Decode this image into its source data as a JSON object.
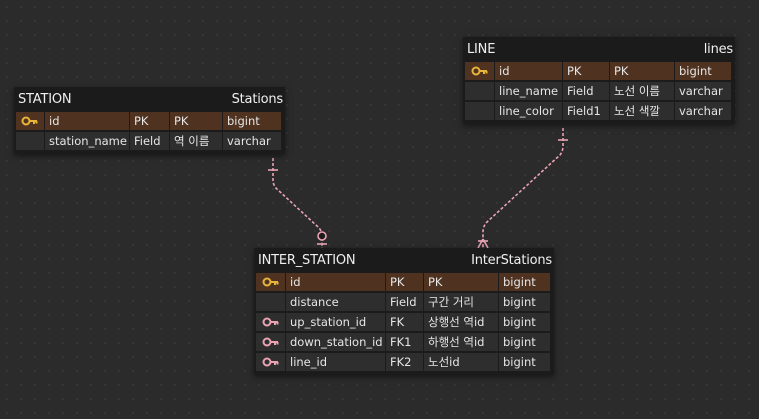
{
  "colors": {
    "background": "#2b2b2b",
    "table_bg": "#1b1b1b",
    "pk_row": "#4f3320",
    "cell": "#2e2e2e",
    "pk_key_icon": "#e8b53a",
    "fk_key_icon": "#e9a3b3",
    "connector": "#e9a3b3"
  },
  "entities": {
    "station": {
      "name": "STATION",
      "table": "Stations",
      "rows": [
        {
          "icon": "primary-key-icon",
          "name": "id",
          "key": "PK",
          "comment": "PK",
          "type": "bigint"
        },
        {
          "icon": "",
          "name": "station_name",
          "key": "Field",
          "comment": "역 이름",
          "type": "varchar"
        }
      ]
    },
    "line": {
      "name": "LINE",
      "table": "lines",
      "rows": [
        {
          "icon": "primary-key-icon",
          "name": "id",
          "key": "PK",
          "comment": "PK",
          "type": "bigint"
        },
        {
          "icon": "",
          "name": "line_name",
          "key": "Field",
          "comment": "노선 이름",
          "type": "varchar"
        },
        {
          "icon": "",
          "name": "line_color",
          "key": "Field1",
          "comment": "노선 색깔",
          "type": "varchar"
        }
      ]
    },
    "inter_station": {
      "name": "INTER_STATION",
      "table": "InterStations",
      "rows": [
        {
          "icon": "primary-key-icon",
          "name": "id",
          "key": "PK",
          "comment": "PK",
          "type": "bigint"
        },
        {
          "icon": "",
          "name": "distance",
          "key": "Field",
          "comment": "구간 거리",
          "type": "bigint"
        },
        {
          "icon": "foreign-key-icon",
          "name": "up_station_id",
          "key": "FK",
          "comment": "상행선 역id",
          "type": "bigint"
        },
        {
          "icon": "foreign-key-icon",
          "name": "down_station_id",
          "key": "FK1",
          "comment": "하행선 역id",
          "type": "bigint"
        },
        {
          "icon": "foreign-key-icon",
          "name": "line_id",
          "key": "FK2",
          "comment": "노선id",
          "type": "bigint"
        }
      ]
    }
  },
  "relationships": [
    {
      "from": "station",
      "to": "inter_station",
      "from_cardinality": "one",
      "to_cardinality": "zero-or-one"
    },
    {
      "from": "line",
      "to": "inter_station",
      "from_cardinality": "one",
      "to_cardinality": "many"
    }
  ]
}
